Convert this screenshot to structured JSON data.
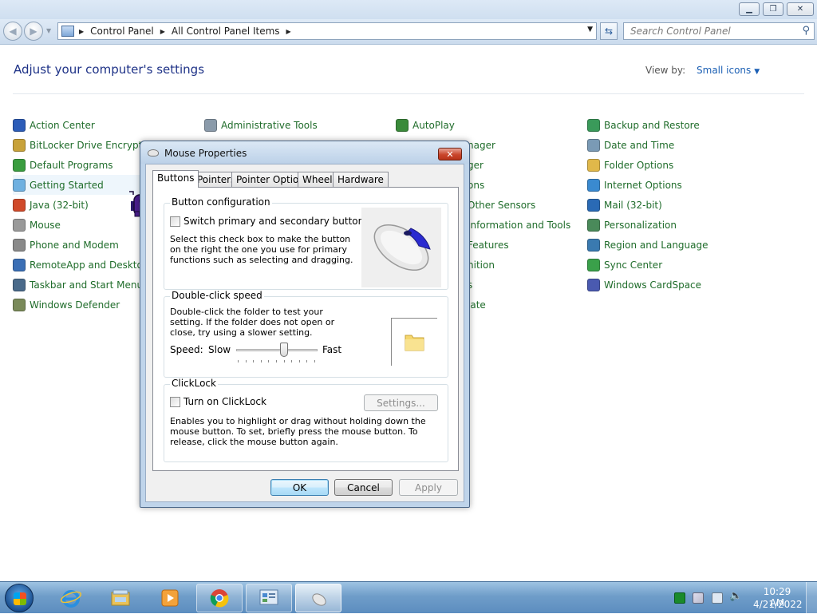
{
  "explorer": {
    "breadcrumb": [
      "Control Panel",
      "All Control Panel Items"
    ],
    "search_placeholder": "Search Control Panel"
  },
  "content": {
    "title": "Adjust your computer's settings",
    "view_by_label": "View by:",
    "view_by_value": "Small icons",
    "columns": [
      [
        {
          "label": "Action Center",
          "icon": "flag-icon",
          "color": "#2c5cb8"
        },
        {
          "label": "BitLocker Drive Encryption",
          "icon": "key-icon",
          "color": "#c8a23a"
        },
        {
          "label": "Default Programs",
          "icon": "globe-check-icon",
          "color": "#3a9d3f"
        },
        {
          "label": "Getting Started",
          "icon": "getting-started-icon",
          "color": "#6fb0e0"
        },
        {
          "label": "Java (32-bit)",
          "icon": "java-icon",
          "color": "#d04a2a"
        },
        {
          "label": "Mouse",
          "icon": "mouse-icon",
          "color": "#9a9a9a"
        },
        {
          "label": "Phone and Modem",
          "icon": "phone-icon",
          "color": "#8a8a8a"
        },
        {
          "label": "RemoteApp and Desktop Connections",
          "icon": "remoteapp-icon",
          "color": "#3b6fb5"
        },
        {
          "label": "Taskbar and Start Menu",
          "icon": "taskbar-icon",
          "color": "#4a6a8a"
        },
        {
          "label": "Windows Defender",
          "icon": "defender-icon",
          "color": "#7a8a5a"
        }
      ],
      [
        {
          "label": "Administrative Tools",
          "icon": "admin-tools-icon",
          "color": "#8a9aaa"
        }
      ],
      [
        {
          "label": "AutoPlay",
          "icon": "autoplay-icon",
          "color": "#3a8a3a"
        }
      ],
      [
        {
          "label": "Backup and Restore",
          "icon": "backup-icon",
          "color": "#3a9a5a"
        },
        {
          "label": "Date and Time",
          "icon": "clock-icon",
          "color": "#7a9ab5"
        },
        {
          "label": "Folder Options",
          "icon": "folder-icon",
          "color": "#e0b84a"
        },
        {
          "label": "Internet Options",
          "icon": "internet-icon",
          "color": "#3a8ad0"
        },
        {
          "label": "Mail (32-bit)",
          "icon": "mail-icon",
          "color": "#2a6ab5"
        },
        {
          "label": "Personalization",
          "icon": "personalization-icon",
          "color": "#4a8a5a"
        },
        {
          "label": "Region and Language",
          "icon": "region-icon",
          "color": "#3a7ab0"
        },
        {
          "label": "Sync Center",
          "icon": "sync-icon",
          "color": "#3aa04a"
        },
        {
          "label": "Windows CardSpace",
          "icon": "cardspace-icon",
          "color": "#4a5ab0"
        }
      ]
    ],
    "partial_column": [
      {
        "text": "nager",
        "row": 1
      },
      {
        "text": "ger",
        "row": 2
      },
      {
        "text": "ons",
        "row": 3
      },
      {
        "text": "Other Sensors",
        "row": 4
      },
      {
        "text": "Information and Tools",
        "row": 5
      },
      {
        "text": "Features",
        "row": 6
      },
      {
        "text": "nition",
        "row": 7
      },
      {
        "text": "s",
        "row": 8
      },
      {
        "text": "late",
        "row": 9
      }
    ]
  },
  "dialog": {
    "title": "Mouse Properties",
    "close_label": "✕",
    "tabs": [
      "Buttons",
      "Pointers",
      "Pointer Options",
      "Wheel",
      "Hardware"
    ],
    "button_config": {
      "title": "Button configuration",
      "checkbox": "Switch primary and secondary buttons",
      "description": "Select this check box to make the button on the right the one you use for primary functions such as selecting and dragging."
    },
    "double_click": {
      "title": "Double-click speed",
      "description": "Double-click the folder to test your setting. If the folder does not open or close, try using a slower setting.",
      "speed_label": "Speed:",
      "slow_label": "Slow",
      "fast_label": "Fast",
      "speed_value": 0.6
    },
    "clicklock": {
      "title": "ClickLock",
      "checkbox": "Turn on ClickLock",
      "settings_button": "Settings...",
      "description": "Enables you to highlight or drag without holding down the mouse button. To set, briefly press the mouse button. To release, click the mouse button again."
    },
    "ok_button": "OK",
    "cancel_button": "Cancel",
    "apply_button": "Apply"
  },
  "taskbar": {
    "time": "10:29 AM",
    "date": "4/21/2022"
  },
  "colors": {
    "link_green": "#1f6c2a",
    "title_blue": "#1e3287",
    "link_blue": "#1b5fb4"
  }
}
